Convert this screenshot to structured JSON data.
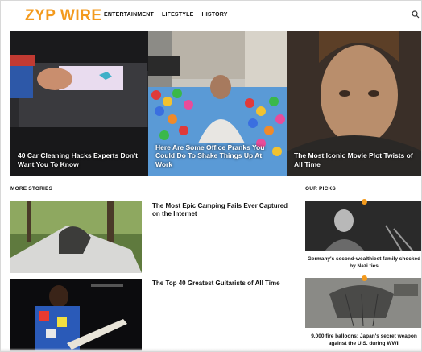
{
  "header": {
    "logo": "ZYP WIRE",
    "nav": [
      "ENTERTAINMENT",
      "LIFESTYLE",
      "HISTORY"
    ],
    "search_icon": "search-icon",
    "colors": {
      "brand": "#f39a1d"
    }
  },
  "hero": [
    {
      "title": "40 Car Cleaning Hacks Experts Don't Want You To Know"
    },
    {
      "title": "Here Are Some Office Pranks You Could Do To Shake Things Up At Work"
    },
    {
      "title": "The Most Iconic Movie Plot Twists of All Time"
    }
  ],
  "more_stories": {
    "label": "MORE STORIES",
    "items": [
      {
        "title": "The Most Epic Camping Fails Ever Captured on the Internet"
      },
      {
        "title": "The Top 40 Greatest Guitarists of All Time"
      }
    ]
  },
  "our_picks": {
    "label": "OUR PICKS",
    "items": [
      {
        "caption": "Germany's second-wealthiest family shocked by Nazi ties"
      },
      {
        "caption": "9,000 fire balloons: Japan's secret weapon against the U.S. during WWII"
      }
    ]
  }
}
